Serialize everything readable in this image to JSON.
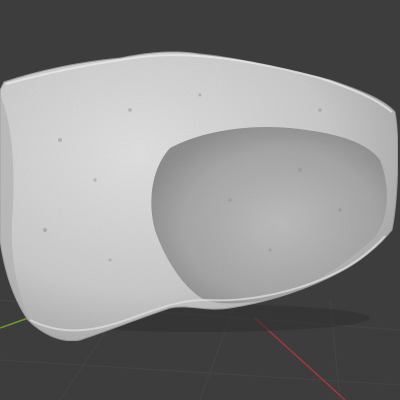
{
  "viewport": {
    "background_color": "#3d3d3d",
    "grid_color": "#454545",
    "x_axis_color": "#a8343f",
    "y_axis_color": "#6f9a2a"
  },
  "model": {
    "object": "rock-scan-mesh",
    "base_color": "#c9c9c9",
    "shadow_color": "#8e8e8e",
    "highlight_color": "#e4e4e4"
  }
}
